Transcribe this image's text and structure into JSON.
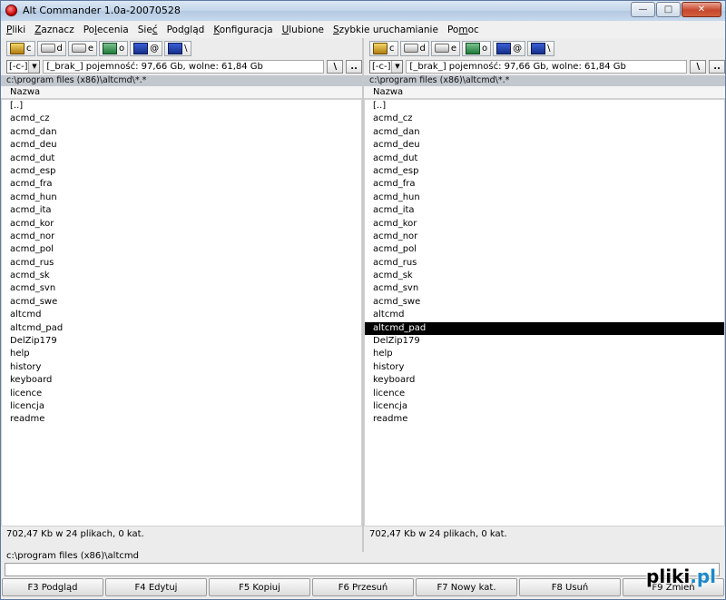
{
  "window": {
    "title": "Alt Commander 1.0a-20070528"
  },
  "menu": [
    {
      "u": "P",
      "rest": "liki"
    },
    {
      "u": "Z",
      "rest": "aznacz"
    },
    {
      "pre": "Po",
      "u": "l",
      "rest": "ecenia"
    },
    {
      "pre": "Sie",
      "u": "ć",
      "rest": ""
    },
    {
      "pre": "Pod",
      "u": "g",
      "rest": "ląd"
    },
    {
      "u": "K",
      "rest": "onfiguracja"
    },
    {
      "u": "U",
      "rest": "lubione"
    },
    {
      "u": "S",
      "rest": "zybkie uruchamianie"
    },
    {
      "pre": "Po",
      "u": "m",
      "rest": "oc"
    }
  ],
  "drives": [
    {
      "letter": "c",
      "icon": "system-drive-icon"
    },
    {
      "letter": "d",
      "icon": "hard-drive-icon"
    },
    {
      "letter": "e",
      "icon": "hard-drive-icon"
    },
    {
      "letter": "o",
      "icon": "network-drive-icon"
    },
    {
      "letter": "@",
      "icon": "computer-icon"
    },
    {
      "letter": "\\",
      "icon": "computer-icon"
    }
  ],
  "left": {
    "drive_combo": "[-c-]",
    "free_info": "[_brak_]  pojemność: 97,66 Gb, wolne: 61,84 Gb",
    "root_btn": "\\",
    "up_btn": "..",
    "path": "c:\\program files (x86)\\altcmd\\*.*",
    "column": "Nazwa",
    "files": [
      "[..]",
      "acmd_cz",
      "acmd_dan",
      "acmd_deu",
      "acmd_dut",
      "acmd_esp",
      "acmd_fra",
      "acmd_hun",
      "acmd_ita",
      "acmd_kor",
      "acmd_nor",
      "acmd_pol",
      "acmd_rus",
      "acmd_sk",
      "acmd_svn",
      "acmd_swe",
      "altcmd",
      "altcmd_pad",
      "DelZip179",
      "help",
      "history",
      "keyboard",
      "licence",
      "licencja",
      "readme"
    ],
    "selected": -1,
    "status": "702,47 Kb w 24 plikach, 0 kat."
  },
  "right": {
    "drive_combo": "[-c-]",
    "free_info": "[_brak_]  pojemność: 97,66 Gb, wolne: 61,84 Gb",
    "root_btn": "\\",
    "up_btn": "..",
    "path": "c:\\program files (x86)\\altcmd\\*.*",
    "column": "Nazwa",
    "files": [
      "[..]",
      "acmd_cz",
      "acmd_dan",
      "acmd_deu",
      "acmd_dut",
      "acmd_esp",
      "acmd_fra",
      "acmd_hun",
      "acmd_ita",
      "acmd_kor",
      "acmd_nor",
      "acmd_pol",
      "acmd_rus",
      "acmd_sk",
      "acmd_svn",
      "acmd_swe",
      "altcmd",
      "altcmd_pad",
      "DelZip179",
      "help",
      "history",
      "keyboard",
      "licence",
      "licencja",
      "readme"
    ],
    "selected": 17,
    "status": "702,47 Kb w 24 plikach, 0 kat."
  },
  "cmd": {
    "path": "c:\\program files (x86)\\altcmd",
    "value": ""
  },
  "fkeys": [
    "F3 Podgląd",
    "F4 Edytuj",
    "F5 Kopiuj",
    "F6 Przesuń",
    "F7 Nowy kat.",
    "F8 Usuń",
    "F9 Zmień"
  ],
  "watermark": {
    "a": "pliki",
    "b": ".pl"
  }
}
